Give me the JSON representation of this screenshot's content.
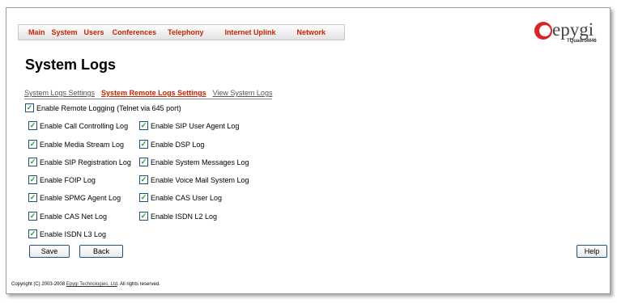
{
  "nav": {
    "items": [
      "Main",
      "System",
      "Users",
      "Conferences",
      "Telephony",
      "Internet Uplink",
      "Network"
    ]
  },
  "logo": {
    "brand": "epygi",
    "model": "TQuadroM46"
  },
  "page": {
    "title": "System Logs"
  },
  "subtabs": {
    "items": [
      "System Logs Settings",
      "System Remote Logs Settings",
      "View System Logs"
    ],
    "active": "System Remote Logs Settings"
  },
  "remote_logging": {
    "label": "Enable Remote Logging (Telnet via 645 port)",
    "checked": true
  },
  "options_left": [
    {
      "label": "Enable Call Controlling Log",
      "checked": true
    },
    {
      "label": "Enable Media Stream Log",
      "checked": true
    },
    {
      "label": "Enable SIP Registration Log",
      "checked": true
    },
    {
      "label": "Enable FOIP Log",
      "checked": true
    },
    {
      "label": "Enable SPMG Agent Log",
      "checked": true
    },
    {
      "label": "Enable CAS Net Log",
      "checked": true
    },
    {
      "label": "Enable ISDN L3 Log",
      "checked": true
    }
  ],
  "options_right": [
    {
      "label": "Enable SIP User Agent Log",
      "checked": true
    },
    {
      "label": "Enable DSP Log",
      "checked": true
    },
    {
      "label": "Enable System Messages Log",
      "checked": true
    },
    {
      "label": "Enable Voice Mail System Log",
      "checked": true
    },
    {
      "label": "Enable CAS User Log",
      "checked": true
    },
    {
      "label": "Enable ISDN L2 Log",
      "checked": true
    }
  ],
  "buttons": {
    "save": "Save",
    "back": "Back",
    "help": "Help"
  },
  "footer": {
    "prefix": "Copyright (C) 2003-2008 ",
    "link": "Epygi Technologies, Ltd",
    "suffix": ". All rights reserved."
  },
  "colors": {
    "accent": "#cc2200",
    "check": "#21a121",
    "border": "#1c5180"
  }
}
